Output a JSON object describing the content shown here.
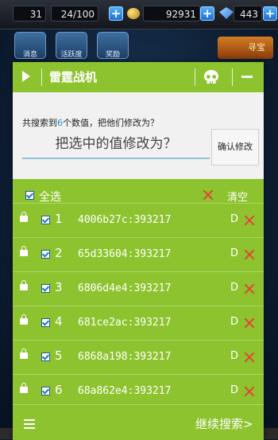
{
  "game": {
    "level_value": "31",
    "energy": "24/100",
    "coins": "92931",
    "gems": "443",
    "icon_labels": [
      "消息",
      "活跃度",
      "奖励"
    ],
    "treasure_label": "寻宝"
  },
  "app": {
    "title": "雷霆战机"
  },
  "search": {
    "found_prefix": "共搜索到",
    "found_count": "6",
    "found_suffix": "个数值，把他们修改为？",
    "input_placeholder": "把选中的值修改为？",
    "confirm_label": "确认修改"
  },
  "list": {
    "select_all_label": "全选",
    "clear_label": "清空",
    "rows": [
      {
        "index": "1",
        "address": "4006b27c:393217",
        "type": "D"
      },
      {
        "index": "2",
        "address": "65d33604:393217",
        "type": "D"
      },
      {
        "index": "3",
        "address": "6806d4e4:393217",
        "type": "D"
      },
      {
        "index": "4",
        "address": "681ce2ac:393217",
        "type": "D"
      },
      {
        "index": "5",
        "address": "6868a198:393217",
        "type": "D"
      },
      {
        "index": "6",
        "address": "68a862e4:393217",
        "type": "D"
      }
    ]
  },
  "footer": {
    "continue_label": "继续搜索>"
  },
  "colors": {
    "panel_green": "#8dc32e",
    "accent_blue": "#1a8fd6",
    "delete_red": "#e04536"
  }
}
